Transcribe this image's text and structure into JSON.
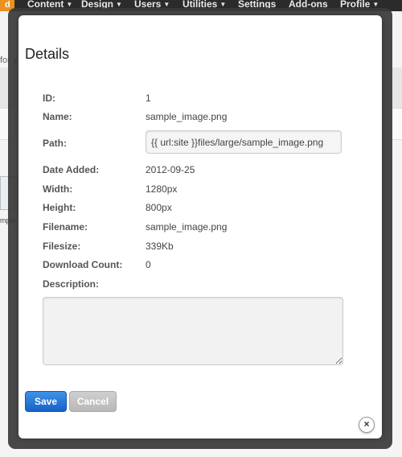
{
  "nav": {
    "brand_text": "d",
    "items": [
      {
        "label": "Content"
      },
      {
        "label": "Design"
      },
      {
        "label": "Users"
      },
      {
        "label": "Utilities"
      },
      {
        "label": "Settings"
      },
      {
        "label": "Add-ons"
      },
      {
        "label": "Profile"
      }
    ]
  },
  "background": {
    "partial_text": "for y",
    "thumb_label": "mple_"
  },
  "modal": {
    "title": "Details",
    "fields": {
      "id": {
        "label": "ID:",
        "value": "1"
      },
      "name": {
        "label": "Name:",
        "value": "sample_image.png"
      },
      "path": {
        "label": "Path:",
        "value": "{{ url:site }}files/large/sample_image.png"
      },
      "date_added": {
        "label": "Date Added:",
        "value": "2012-09-25"
      },
      "width": {
        "label": "Width:",
        "value": "1280px"
      },
      "height": {
        "label": "Height:",
        "value": "800px"
      },
      "filename": {
        "label": "Filename:",
        "value": "sample_image.png"
      },
      "filesize": {
        "label": "Filesize:",
        "value": "339Kb"
      },
      "download_count": {
        "label": "Download Count:",
        "value": "0"
      },
      "description": {
        "label": "Description:",
        "value": ""
      }
    },
    "save_label": "Save",
    "cancel_label": "Cancel",
    "close_icon": "×"
  }
}
